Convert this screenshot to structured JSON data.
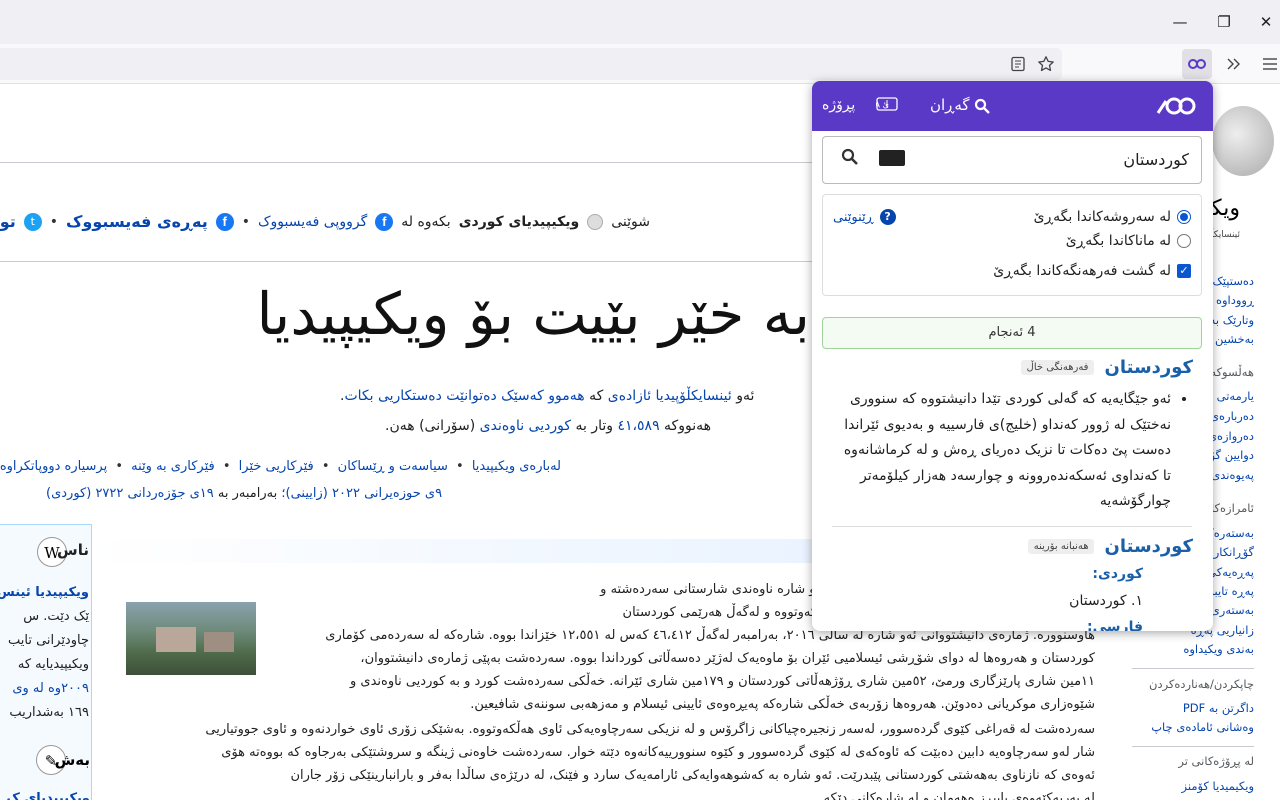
{
  "browser": {
    "window_controls": [
      "minimize",
      "maximize",
      "close"
    ],
    "toolbar_icons": [
      "reader-view-icon",
      "bookmark-star-icon",
      "extension-dictionary-icon",
      "overflow-chevrons-icon",
      "menu-icon"
    ]
  },
  "page": {
    "social": {
      "prefix": "شوێنی",
      "site_name": "ویکیپیدیای کوردی",
      "in_text": "بکەوە لە",
      "fb_group": "گرووپی فەیسبووک",
      "fb_page": "پەڕەی فەیسبووک",
      "twitter_partial": "تو"
    },
    "welcome": "بە خێر بێیت بۆ ویکیپیدیا",
    "intro1_a": "ئەو",
    "intro1_link": "ئینسایکڵۆپیدیا ئازادەی",
    "intro1_b": "کە",
    "intro1_link2": "هەموو کەسێک دەتوانێت دەستکاریی بکات",
    "intro2_a": "هەنووکە",
    "intro2_count": "٤١،٥٨٩",
    "intro2_b": "وتار بە",
    "intro2_link": "کوردیی ناوەندی",
    "intro2_c": "(سۆرانی) هەن.",
    "portals": [
      "لەبارەی ویکیپیدیا",
      "سیاسەت و ڕێساکان",
      "فێرکاریی خێرا",
      "فێرکاری بە وێنە",
      "پرسیارە دووپاتکراوەکان",
      "ی"
    ],
    "date_a": "٩ی حوزەیرانی ٢٠٢٢ (زایینی)؛",
    "date_b": "بەرامبەر بە",
    "date_c": "١٩ی جۆزەردانی ٢٧٢٢ (کوردی)",
    "left_head": "ناس",
    "left_lines": [
      "ویکیپیدیا ئینس",
      "ێک دێت. س",
      "چاودێرانی تایب",
      "ویکیپیدیایە کە",
      "٢٠٠٩وە لە وی",
      "١٦٩ بەشداریب"
    ],
    "left_head2": "بەش",
    "left_line2": "ویکیپیدیای ک",
    "article_lines": [
      "لە باشووری ڕۆژاوای پارێزگای ورمێ هەڵکەوتووە. ئەو شارە ناوەندی شارستانی سەردەشتە و",
      "ت. سەردەشت لە نێوان سنووری ئێران و عێراق هەڵکەوتووە و لەگەڵ هەرێمی کوردستان",
      "هاوسنوورە. ژمارەی دانیشتووانی ئەو شارە لە ساڵی ٢٠١٦، بەرامبەر لەگەڵ ٤٦،٤١٢ کەس لە ١٢،٥٥١ خێزاندا بووە. شارەکە لە سەردەمی کۆماری",
      "کوردستان و هەروەها لە دوای شۆڕشی ئیسلامیی ئێران بۆ ماوەیەک لەژێر دەسەڵاتی کورداندا بووە. سەردەشت بەپێی ژمارەی دانیشتووان،",
      "١١مین شاری پارێزگاری ورمێ، ٥٢مین شاری ڕۆژهەڵاتی کوردستان و ١٧٩مین شاری ئێرانە. خەڵکی سەردەشت کورد و بە کوردیی ناوەندی و",
      "شێوەزاری موکریانی دەدوێن. هەروەها زۆربەی خەڵکی شارەکە پەیڕەوەی ئایینی ئیسلام و مەزهەبی سوننەی شافیعین."
    ],
    "article2_lines": [
      "سەردەشت لە قەراغی کێوی گردەسوور، لەسەر زنجیرەچیاکانی زاگرۆس و لە نزیکی سەرچاوەیەکی ئاوی هەڵکەوتووە. بەشێکی زۆری ئاوی خواردنەوە و ئاوی جووتیاریی",
      "شار لەو سەرچاوەیە دابین دەبێت کە ئاوەکەی لە کێوی گردەسوور و کێوە سنوورییەکانەوە دێتە خوار. سەردەشت خاوەنی ژینگە و سروشتێکی بەرجاوە کە بووەتە هۆی",
      "ئەوەی کە نازناوی بەهەشتی کوردستانی پێبدرێت. ئەو شارە بە کەشوهەوایەکی ئارامەیەک سارد و فێنک، لە درێژەی ساڵدا بەفر و بارانبارینێکی زۆر جاران",
      "لە بەرپەکێەوەی بابیڕز ەهەمان و لە شارەکانی دێکە..."
    ],
    "right": {
      "title": "ویکی",
      "subtitle": "ئینسایکڵۆپ",
      "items": [
        "دەستپێک",
        "ڕووداوە هە",
        "وتارێک بە هە",
        "بەخشین بە"
      ],
      "head1": "هەڵسوکەو",
      "items2": [
        "یارمەتی",
        "دەربارەی و",
        "دەروازەی کۆ",
        "دوایین گۆڕا",
        "پەیوەندی بە"
      ],
      "head2": "ئامرازەکان",
      "items3": [
        "بەستەرەکا",
        "گۆڕانکارییە",
        "پەڕەیەکی ت",
        "پەڕە تایبەتی",
        "بەستەری هە",
        "زانیاریی پەڕە",
        "بەندی ویکیداوە"
      ],
      "head3": "چاپکردن/هەناردەکردن",
      "items4": [
        "داگرتن بە PDF",
        "وەشانی ئامادەی چاپ"
      ],
      "head4": "لە پڕۆژەکانی تر",
      "items5": [
        "ویکیمیدیا کۆمنز"
      ]
    }
  },
  "popup": {
    "header_search": "گەڕان",
    "header_project": "پڕۆژە",
    "search_value": "کوردستان",
    "opt1": "لە سەروشەکاندا بگەڕێ",
    "opt2": "لە ماناکاندا بگەڕێ",
    "opt3": "لە گشت فەرهەنگەکاندا بگەڕێ",
    "help": "ڕێنوێنی",
    "results": "4 ئەنجام",
    "entry1_word": "کوردستان",
    "entry1_src": "فەرهەنگی خاڵ",
    "entry1_def": "ئەو جێگایەیە کە گەلی کوردی تێدا دانیشتووە کە سنووری نەختێک لە ژوور کەنداو (خلیج)ی فارسییە و بەدیوی ئێراندا دەست پێ دەکات تا نزیک دەریای ڕەش و لە کرماشانەوە تا کەنداوی ئەسکەندەروونە و چوارسەد هەزار کیلۆمەتر چوارگۆشەیە",
    "entry2_word": "کوردستان",
    "entry2_src": "هەنبانە بۆرینە",
    "entry2_lang1": "کوردی:",
    "entry2_sense": "١. کوردستان",
    "entry2_lang2": "فارسی:",
    "colors": {
      "header": "#5a39c6",
      "link": "#1a5fa8",
      "results_border": "#9fd39a"
    }
  }
}
